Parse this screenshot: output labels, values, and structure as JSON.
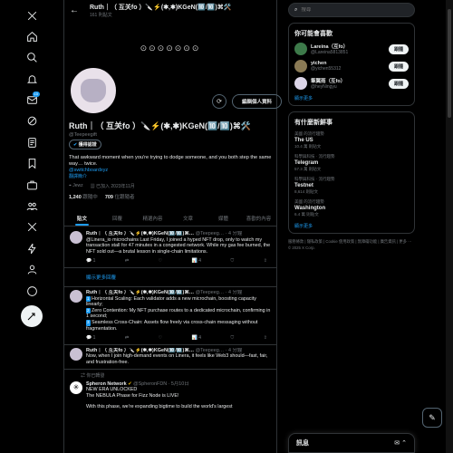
{
  "header": {
    "back": "←",
    "name": "Ruth｜（ 互关fo ）🔪⚡(✱,✱)KGeN(🔟/🔟)⌘🛠️",
    "posts": "161 則貼文"
  },
  "banner": {
    "symbols": "⊙⊙⊙⊙⊙⊙⊙"
  },
  "profile": {
    "edit_label": "編輯個人資料",
    "name": "Ruth｜（ 互关fo ）🔪⚡(✱,✱)KGeN(🔟/🔟)⌘🛠️",
    "handle": "@Teepeegift",
    "verify_label": "獲得認證",
    "bio": "That awkward moment when you're trying to dodge someone, and you both step the same way… twice.",
    "link1": "@switchboardxyz",
    "link2": "翻譯簡介",
    "location": "Jewz",
    "joined": "已加入 2023年11月",
    "following_count": "1,240",
    "following_label": "跟隨中",
    "followers_count": "709",
    "followers_label": "位跟隨者"
  },
  "tabs": [
    "貼文",
    "回覆",
    "精選內容",
    "文章",
    "媒體",
    "喜歡的內容"
  ],
  "tweets": [
    {
      "author": "Ruth｜（ 互关fo ）🔪⚡(✱,✱)KGeN(🔟/🔟)⌘…",
      "meta": "@Teepeeg… · 4 分鐘",
      "text": "@Linera_io microchains Last Friday, I joined a hyped NFT drop, only to watch my transaction stall for 47 minutes in a congested network. While my gas fee burned, the NFT sold out—a brutal lesson in single-chain limitations.",
      "reply": "1",
      "retweet": "",
      "like": "",
      "views": "4"
    }
  ],
  "show_replies": "顯示更多回覆",
  "tweet2": {
    "author": "Ruth｜（ 互关fo ）🔪⚡(✱,✱)KGeN(🔟/🔟)⌘…",
    "meta": "@Teepeeg… · 4 分鐘",
    "n1": "1",
    "l1": "Horizontal Scaling: Each validator adds a new microchain, boosting capacity linearly;",
    "n2": "2",
    "l2": "Zero Contention: My NFT purchase routes to a dedicated microchain, confirming in 1 second;",
    "n3": "3",
    "l3": "Seamless Cross-Chain: Assets flow freely via cross-chain messaging without fragmentation.",
    "reply": "1",
    "views": "4"
  },
  "tweet3": {
    "author": "Ruth｜（ 互关fo ）🔪⚡(✱,✱)KGeN(🔟/🔟)⌘…",
    "meta": "@Teepeeg… · 4 分鐘",
    "text": "Now, when I join high-demand events on Linera, it feels like Web3 should—fast, fair, and frustration-free."
  },
  "reposted_label": "你已轉發",
  "tweet4": {
    "author": "Spheron Network",
    "meta": "@SpheronFDN · 5月10日",
    "line1": "NEW ERA UNLOCKED",
    "line2": "The NEBULA Phase for Fizz Node is LIVE!",
    "line3": "With this phase, we're expanding bigtime to build the world's largest"
  },
  "search": {
    "placeholder": "搜尋"
  },
  "who": {
    "title": "你可能會喜歡",
    "follow_label": "跟隨",
    "items": [
      {
        "name": "Lareina（互fo）",
        "handle": "@Lareina5813851"
      },
      {
        "name": "yichen",
        "handle": "@yichen55312"
      },
      {
        "name": "筆翼雨（互fo）",
        "handle": "@heyNingyu"
      }
    ],
    "show_more": "顯示更多"
  },
  "trends": {
    "title": "有什麼新鮮事",
    "items": [
      {
        "meta": "美國 的流行趨勢",
        "title": "The US",
        "count": "10.4 萬 則貼文"
      },
      {
        "meta": "科學與科技 · 流行趨勢",
        "title": "Telegram",
        "count": "57.3 萬 則貼文"
      },
      {
        "meta": "科學與科技 · 流行趨勢",
        "title": "Testnet",
        "count": "8,614 則貼文"
      },
      {
        "meta": "美國 的流行趨勢",
        "title": "Washington",
        "count": "6.4 萬 則貼文"
      }
    ],
    "show_more": "顯示更多"
  },
  "footer": "服務條款 | 隱私政策 | Cookie 使用政策 | 無障礙功能 | 廣告資訊 | 更多 ··· © 2025 X Corp.",
  "messages": {
    "label": "訊息"
  }
}
